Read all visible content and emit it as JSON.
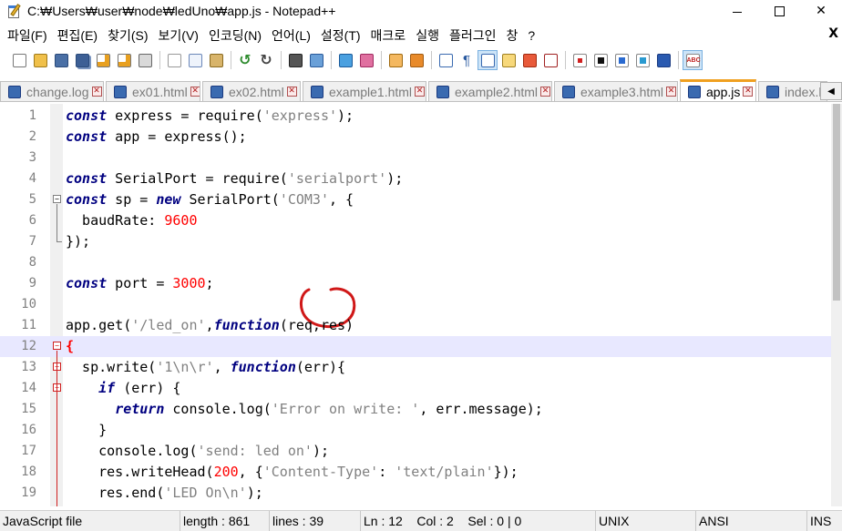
{
  "window": {
    "title": "C:₩Users₩user₩node₩ledUno₩app.js - Notepad++",
    "minimize_icon": "minimize-icon",
    "maximize_icon": "maximize-icon",
    "close_label": "✕"
  },
  "menu": {
    "items": [
      "파일(F)",
      "편집(E)",
      "찾기(S)",
      "보기(V)",
      "인코딩(N)",
      "언어(L)",
      "설정(T)",
      "매크로",
      "실행",
      "플러그인",
      "창",
      "?"
    ],
    "close_label": "X"
  },
  "toolbar": {
    "icons": [
      "new-file-icon",
      "open-file-icon",
      "save-icon",
      "save-all-icon",
      "close-file-icon",
      "close-all-icon",
      "print-icon",
      "cut-icon",
      "copy-icon",
      "paste-icon",
      "undo-icon",
      "redo-icon",
      "find-icon",
      "replace-icon",
      "zoom-in-icon",
      "zoom-out-icon",
      "sync-vertical-icon",
      "sync-horizontal-icon",
      "word-wrap-icon",
      "show-all-chars-icon",
      "indent-guide-icon",
      "doc-map-icon",
      "function-list-icon",
      "folder-workspace-icon",
      "record-macro-icon",
      "stop-macro-icon",
      "play-macro-icon",
      "run-macro-multiple-icon",
      "save-macro-icon",
      "spell-check-icon"
    ],
    "spell_label": "ABC"
  },
  "tabs": [
    {
      "label": "change.log",
      "active": false
    },
    {
      "label": "ex01.html",
      "active": false
    },
    {
      "label": "ex02.html",
      "active": false
    },
    {
      "label": "example1.html",
      "active": false
    },
    {
      "label": "example2.html",
      "active": false
    },
    {
      "label": "example3.html",
      "active": false
    },
    {
      "label": "app.js",
      "active": true
    },
    {
      "label": "index.h",
      "active": false
    }
  ],
  "tab_close_label": "✕",
  "tab_scroll_label": "◀",
  "editor": {
    "line_numbers": [
      "1",
      "2",
      "3",
      "4",
      "5",
      "6",
      "7",
      "8",
      "9",
      "10",
      "11",
      "12",
      "13",
      "14",
      "15",
      "16",
      "17",
      "18",
      "19"
    ],
    "current_line": 12,
    "lines": [
      [
        {
          "t": "const",
          "c": "kw"
        },
        {
          "t": " express = require(",
          "c": "ident"
        },
        {
          "t": "'express'",
          "c": "str"
        },
        {
          "t": ");",
          "c": "ident"
        }
      ],
      [
        {
          "t": "const",
          "c": "kw"
        },
        {
          "t": " app = express();",
          "c": "ident"
        }
      ],
      [],
      [
        {
          "t": "const",
          "c": "kw"
        },
        {
          "t": " SerialPort = require(",
          "c": "ident"
        },
        {
          "t": "'serialport'",
          "c": "str"
        },
        {
          "t": ");",
          "c": "ident"
        }
      ],
      [
        {
          "t": "const",
          "c": "kw"
        },
        {
          "t": " sp = ",
          "c": "ident"
        },
        {
          "t": "new",
          "c": "kw"
        },
        {
          "t": " SerialPort(",
          "c": "ident"
        },
        {
          "t": "'COM3'",
          "c": "str"
        },
        {
          "t": ", {",
          "c": "ident"
        }
      ],
      [
        {
          "t": "  baudRate: ",
          "c": "ident"
        },
        {
          "t": "9600",
          "c": "num"
        }
      ],
      [
        {
          "t": "});",
          "c": "ident"
        }
      ],
      [],
      [
        {
          "t": "const",
          "c": "kw"
        },
        {
          "t": " port = ",
          "c": "ident"
        },
        {
          "t": "3000",
          "c": "num"
        },
        {
          "t": ";",
          "c": "ident"
        }
      ],
      [],
      [
        {
          "t": "app.get(",
          "c": "ident"
        },
        {
          "t": "'/led_on'",
          "c": "str"
        },
        {
          "t": ",",
          "c": "ident"
        },
        {
          "t": "function",
          "c": "kw"
        },
        {
          "t": "(req,res)",
          "c": "ident"
        }
      ],
      [
        {
          "t": "{",
          "c": "brace-hl"
        }
      ],
      [
        {
          "t": "  sp.write(",
          "c": "ident"
        },
        {
          "t": "'1\\n\\r'",
          "c": "str"
        },
        {
          "t": ", ",
          "c": "ident"
        },
        {
          "t": "function",
          "c": "kw"
        },
        {
          "t": "(err){",
          "c": "ident"
        }
      ],
      [
        {
          "t": "    ",
          "c": "ident"
        },
        {
          "t": "if",
          "c": "kw"
        },
        {
          "t": " (err) {",
          "c": "ident"
        }
      ],
      [
        {
          "t": "      ",
          "c": "ident"
        },
        {
          "t": "return",
          "c": "kw"
        },
        {
          "t": " console.log(",
          "c": "ident"
        },
        {
          "t": "'Error on write: '",
          "c": "str"
        },
        {
          "t": ", err.message);",
          "c": "ident"
        }
      ],
      [
        {
          "t": "    }",
          "c": "ident"
        }
      ],
      [
        {
          "t": "    console.log(",
          "c": "ident"
        },
        {
          "t": "'send: led on'",
          "c": "str"
        },
        {
          "t": ");",
          "c": "ident"
        }
      ],
      [
        {
          "t": "    res.writeHead(",
          "c": "ident"
        },
        {
          "t": "200",
          "c": "num"
        },
        {
          "t": ", {",
          "c": "ident"
        },
        {
          "t": "'Content-Type'",
          "c": "str"
        },
        {
          "t": ": ",
          "c": "ident"
        },
        {
          "t": "'text/plain'",
          "c": "str"
        },
        {
          "t": "});",
          "c": "ident"
        }
      ],
      [
        {
          "t": "    res.end(",
          "c": "ident"
        },
        {
          "t": "'LED On\\n'",
          "c": "str"
        },
        {
          "t": ");",
          "c": "ident"
        }
      ]
    ],
    "fold_markers": [
      {
        "line": 5,
        "symbol": "−",
        "red": false
      },
      {
        "line": 12,
        "symbol": "−",
        "red": true
      },
      {
        "line": 13,
        "symbol": "−",
        "red": true
      },
      {
        "line": 14,
        "symbol": "−",
        "red": true
      }
    ]
  },
  "colors": {
    "keyword": "#000080",
    "string": "#808080",
    "number": "#ff0000",
    "current_line": "#e8e8ff",
    "annotation": "#d01818",
    "active_tab_accent": "#f0a020"
  },
  "status": {
    "language": "JavaScript file",
    "length": "length : 861",
    "lines": "lines : 39",
    "position": "Ln : 12    Col : 2    Sel : 0 | 0",
    "eol": "UNIX",
    "encoding": "ANSI",
    "mode": "INS"
  }
}
